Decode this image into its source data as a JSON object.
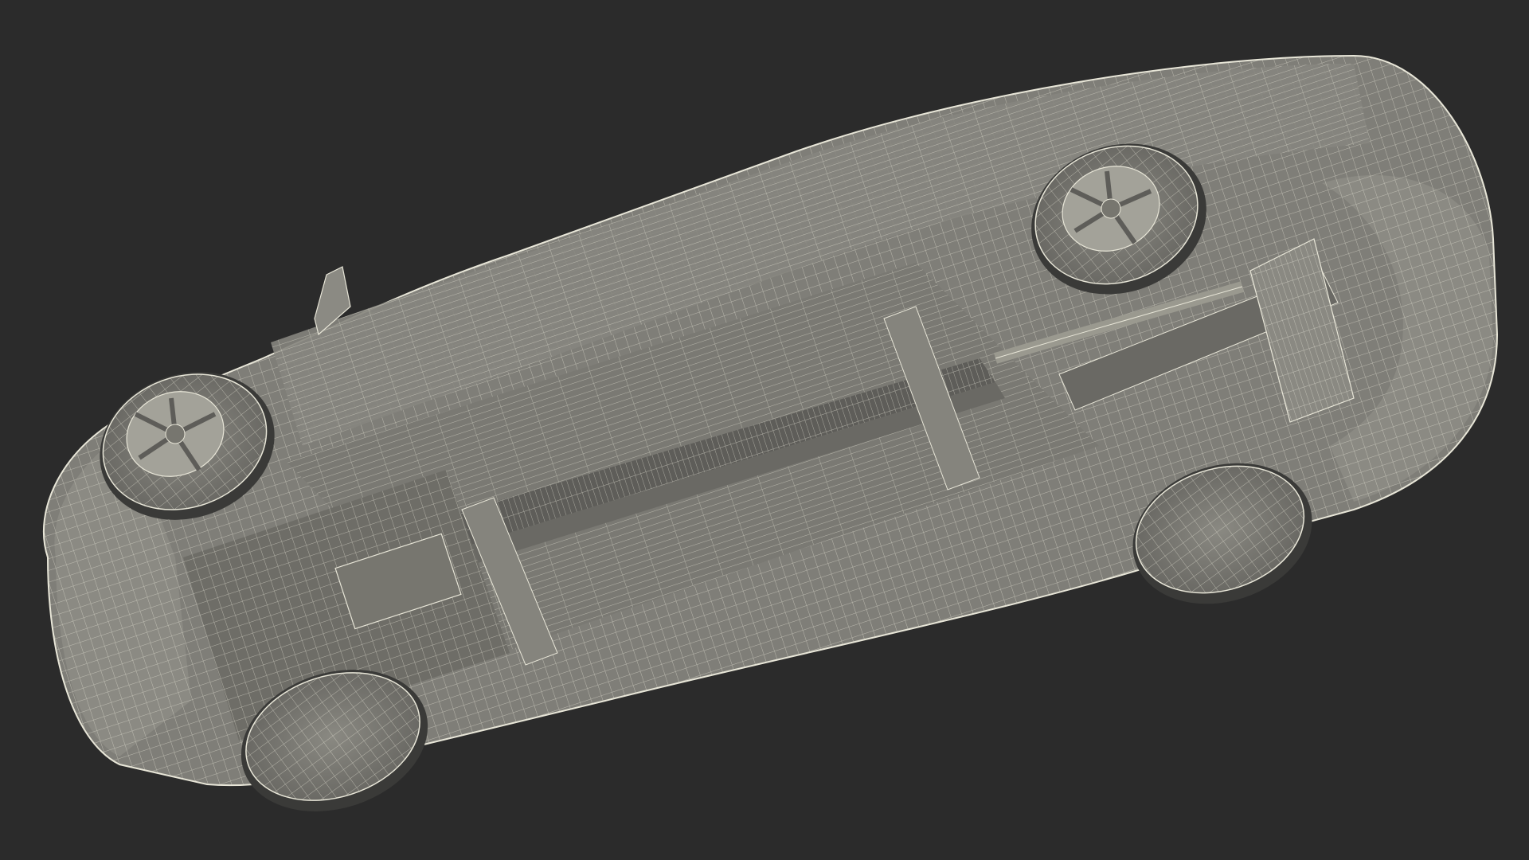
{
  "scene": {
    "background_color": "#2b2b2b",
    "mesh_fill_color": "#7f7e78",
    "mesh_dark_color": "#5e5d59",
    "wire_color": "#e8e6d8",
    "subject": "car-underside-wireframe-render"
  }
}
